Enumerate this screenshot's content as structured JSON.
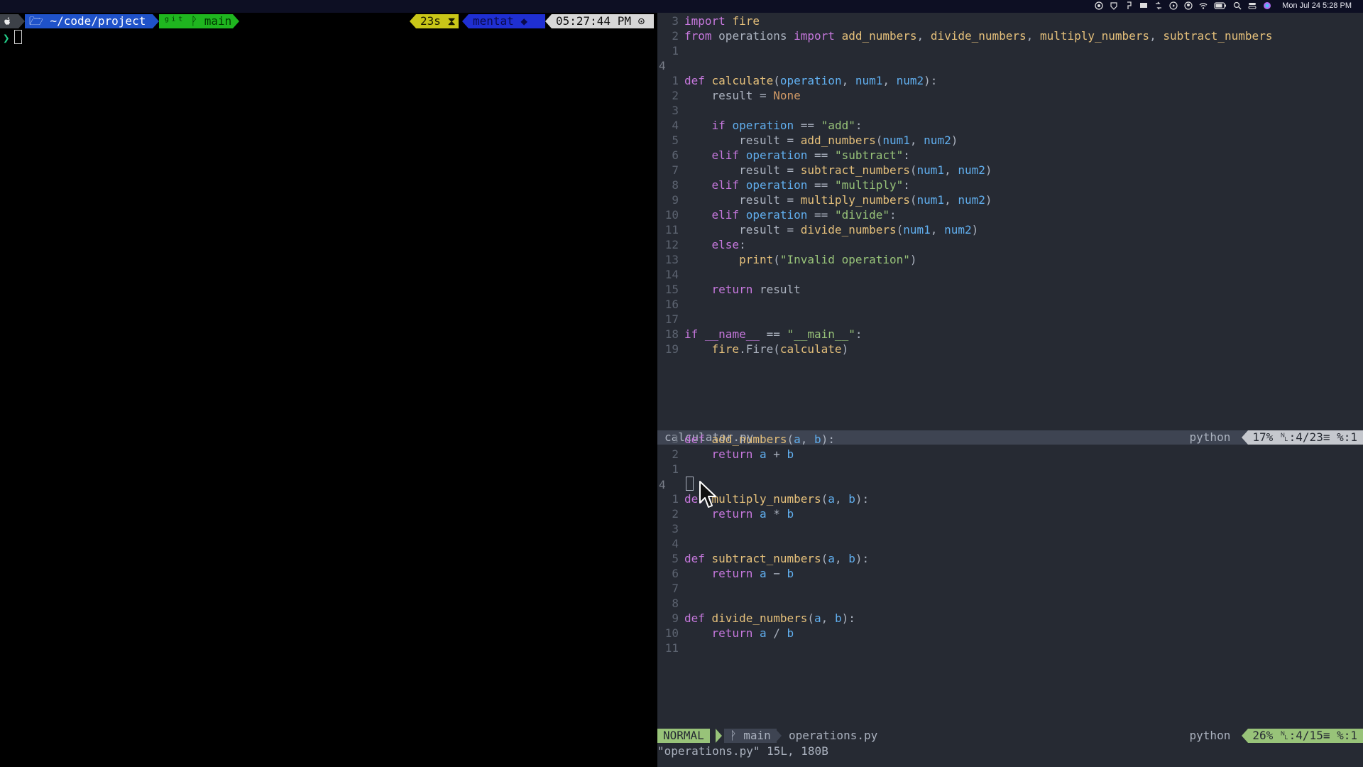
{
  "menubar": {
    "apple": "",
    "clock": "Mon Jul 24  5:28 PM"
  },
  "terminal": {
    "path": "🗁 ~/code/project",
    "git_branch": "ᵍⁱᵗ ᚹ main",
    "duration": "23s ⧗",
    "host": "mentat ◆",
    "time": "05:27:44 PM ⊙",
    "prompt_symbol": "❯"
  },
  "top_pane": {
    "lines": [
      {
        "n": "3",
        "code": [
          [
            "kw",
            "import "
          ],
          [
            "fn",
            "fire"
          ]
        ]
      },
      {
        "n": "2",
        "code": [
          [
            "kw",
            "from "
          ],
          [
            "tx",
            "operations "
          ],
          [
            "kw",
            "import "
          ],
          [
            "fn",
            "add_numbers"
          ],
          [
            "tx",
            ", "
          ],
          [
            "fn",
            "divide_numbers"
          ],
          [
            "tx",
            ", "
          ],
          [
            "fn",
            "multiply_numbers"
          ],
          [
            "tx",
            ", "
          ],
          [
            "fn",
            "subtract_numbers"
          ]
        ]
      },
      {
        "n": "1",
        "code": []
      },
      {
        "n": "4",
        "cur": true,
        "code": []
      },
      {
        "n": "1",
        "code": [
          [
            "kw",
            "def "
          ],
          [
            "fn",
            "calculate"
          ],
          [
            "tx",
            "("
          ],
          [
            "ar",
            "operation"
          ],
          [
            "tx",
            ", "
          ],
          [
            "ar",
            "num1"
          ],
          [
            "tx",
            ", "
          ],
          [
            "ar",
            "num2"
          ],
          [
            "tx",
            "):"
          ]
        ]
      },
      {
        "n": "2",
        "code": [
          [
            "tx",
            "    result = "
          ],
          [
            "bi",
            "None"
          ]
        ]
      },
      {
        "n": "3",
        "code": []
      },
      {
        "n": "4",
        "code": [
          [
            "tx",
            "    "
          ],
          [
            "kw",
            "if "
          ],
          [
            "ar",
            "operation"
          ],
          [
            "tx",
            " == "
          ],
          [
            "st",
            "\"add\""
          ],
          [
            "tx",
            ":"
          ]
        ]
      },
      {
        "n": "5",
        "code": [
          [
            "tx",
            "        result = "
          ],
          [
            "fn",
            "add_numbers"
          ],
          [
            "tx",
            "("
          ],
          [
            "ar",
            "num1"
          ],
          [
            "tx",
            ", "
          ],
          [
            "ar",
            "num2"
          ],
          [
            "tx",
            ")"
          ]
        ]
      },
      {
        "n": "6",
        "code": [
          [
            "tx",
            "    "
          ],
          [
            "kw",
            "elif "
          ],
          [
            "ar",
            "operation"
          ],
          [
            "tx",
            " == "
          ],
          [
            "st",
            "\"subtract\""
          ],
          [
            "tx",
            ":"
          ]
        ]
      },
      {
        "n": "7",
        "code": [
          [
            "tx",
            "        result = "
          ],
          [
            "fn",
            "subtract_numbers"
          ],
          [
            "tx",
            "("
          ],
          [
            "ar",
            "num1"
          ],
          [
            "tx",
            ", "
          ],
          [
            "ar",
            "num2"
          ],
          [
            "tx",
            ")"
          ]
        ]
      },
      {
        "n": "8",
        "code": [
          [
            "tx",
            "    "
          ],
          [
            "kw",
            "elif "
          ],
          [
            "ar",
            "operation"
          ],
          [
            "tx",
            " == "
          ],
          [
            "st",
            "\"multiply\""
          ],
          [
            "tx",
            ":"
          ]
        ]
      },
      {
        "n": "9",
        "code": [
          [
            "tx",
            "        result = "
          ],
          [
            "fn",
            "multiply_numbers"
          ],
          [
            "tx",
            "("
          ],
          [
            "ar",
            "num1"
          ],
          [
            "tx",
            ", "
          ],
          [
            "ar",
            "num2"
          ],
          [
            "tx",
            ")"
          ]
        ]
      },
      {
        "n": "10",
        "code": [
          [
            "tx",
            "    "
          ],
          [
            "kw",
            "elif "
          ],
          [
            "ar",
            "operation"
          ],
          [
            "tx",
            " == "
          ],
          [
            "st",
            "\"divide\""
          ],
          [
            "tx",
            ":"
          ]
        ]
      },
      {
        "n": "11",
        "code": [
          [
            "tx",
            "        result = "
          ],
          [
            "fn",
            "divide_numbers"
          ],
          [
            "tx",
            "("
          ],
          [
            "ar",
            "num1"
          ],
          [
            "tx",
            ", "
          ],
          [
            "ar",
            "num2"
          ],
          [
            "tx",
            ")"
          ]
        ]
      },
      {
        "n": "12",
        "code": [
          [
            "tx",
            "    "
          ],
          [
            "kw",
            "else"
          ],
          [
            "tx",
            ":"
          ]
        ]
      },
      {
        "n": "13",
        "code": [
          [
            "tx",
            "        "
          ],
          [
            "fn",
            "print"
          ],
          [
            "tx",
            "("
          ],
          [
            "st",
            "\"Invalid operation\""
          ],
          [
            "tx",
            ")"
          ]
        ]
      },
      {
        "n": "14",
        "code": []
      },
      {
        "n": "15",
        "code": [
          [
            "tx",
            "    "
          ],
          [
            "kw",
            "return "
          ],
          [
            "tx",
            "result"
          ]
        ]
      },
      {
        "n": "16",
        "code": []
      },
      {
        "n": "17",
        "code": []
      },
      {
        "n": "18",
        "code": [
          [
            "kw",
            "if "
          ],
          [
            "dn",
            "__name__"
          ],
          [
            "tx",
            " == "
          ],
          [
            "st",
            "\"__main__\""
          ],
          [
            "tx",
            ":"
          ]
        ]
      },
      {
        "n": "19",
        "code": [
          [
            "tx",
            "    "
          ],
          [
            "fn",
            "fire"
          ],
          [
            "tx",
            ".Fire("
          ],
          [
            "fn",
            "calculate"
          ],
          [
            "tx",
            ")"
          ]
        ]
      }
    ]
  },
  "top_status": {
    "filename": "calculator.py",
    "filetype": "python",
    "position": "17% ␤:4/23≡ %:1"
  },
  "bottom_pane": {
    "lines": [
      {
        "n": "3",
        "code": [
          [
            "kw",
            "def "
          ],
          [
            "fn",
            "add_numbers"
          ],
          [
            "tx",
            "("
          ],
          [
            "ar",
            "a"
          ],
          [
            "tx",
            ", "
          ],
          [
            "ar",
            "b"
          ],
          [
            "tx",
            "):"
          ]
        ]
      },
      {
        "n": "2",
        "code": [
          [
            "tx",
            "    "
          ],
          [
            "kw",
            "return "
          ],
          [
            "ar",
            "a"
          ],
          [
            "tx",
            " + "
          ],
          [
            "ar",
            "b"
          ]
        ]
      },
      {
        "n": "1",
        "code": []
      },
      {
        "n": "4",
        "cur": true,
        "code": [],
        "cursor": true
      },
      {
        "n": "1",
        "code": [
          [
            "kw",
            "def "
          ],
          [
            "fn",
            "multiply_numbers"
          ],
          [
            "tx",
            "("
          ],
          [
            "ar",
            "a"
          ],
          [
            "tx",
            ", "
          ],
          [
            "ar",
            "b"
          ],
          [
            "tx",
            "):"
          ]
        ]
      },
      {
        "n": "2",
        "code": [
          [
            "tx",
            "    "
          ],
          [
            "kw",
            "return "
          ],
          [
            "ar",
            "a"
          ],
          [
            "tx",
            " * "
          ],
          [
            "ar",
            "b"
          ]
        ]
      },
      {
        "n": "3",
        "code": []
      },
      {
        "n": "4",
        "code": []
      },
      {
        "n": "5",
        "code": [
          [
            "kw",
            "def "
          ],
          [
            "fn",
            "subtract_numbers"
          ],
          [
            "tx",
            "("
          ],
          [
            "ar",
            "a"
          ],
          [
            "tx",
            ", "
          ],
          [
            "ar",
            "b"
          ],
          [
            "tx",
            "):"
          ]
        ]
      },
      {
        "n": "6",
        "code": [
          [
            "tx",
            "    "
          ],
          [
            "kw",
            "return "
          ],
          [
            "ar",
            "a"
          ],
          [
            "tx",
            " − "
          ],
          [
            "ar",
            "b"
          ]
        ]
      },
      {
        "n": "7",
        "code": []
      },
      {
        "n": "8",
        "code": []
      },
      {
        "n": "9",
        "code": [
          [
            "kw",
            "def "
          ],
          [
            "fn",
            "divide_numbers"
          ],
          [
            "tx",
            "("
          ],
          [
            "ar",
            "a"
          ],
          [
            "tx",
            ", "
          ],
          [
            "ar",
            "b"
          ],
          [
            "tx",
            "):"
          ]
        ]
      },
      {
        "n": "10",
        "code": [
          [
            "tx",
            "    "
          ],
          [
            "kw",
            "return "
          ],
          [
            "ar",
            "a"
          ],
          [
            "tx",
            " / "
          ],
          [
            "ar",
            "b"
          ]
        ]
      },
      {
        "n": "11",
        "code": []
      }
    ]
  },
  "bottom_status": {
    "mode": "NORMAL",
    "branch": "ᚹ main",
    "filename": "operations.py",
    "filetype": "python",
    "position": "26% ␤:4/15≡ %:1"
  },
  "message": "\"operations.py\" 15L, 180B",
  "colors": {
    "keyword": "#c678dd",
    "function": "#e5c07b",
    "argument": "#61afef",
    "string": "#98c379",
    "builtin": "#d19a66"
  }
}
